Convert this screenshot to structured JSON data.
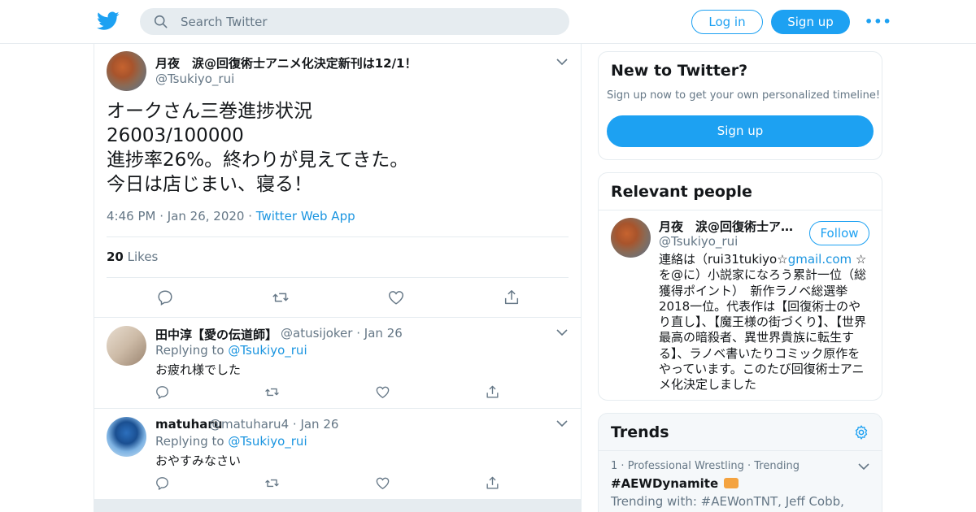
{
  "header": {
    "search_placeholder": "Search Twitter",
    "login_label": "Log in",
    "signup_label": "Sign up",
    "more_label": "•••"
  },
  "tweet": {
    "author_name": "月夜　涙@回復術士アニメ化決定新刊は12/1！",
    "author_handle": "@Tsukiyo_rui",
    "text_lines": [
      "オークさん三巻進捗状況",
      "26003/100000",
      "進捗率26%。終わりが見えてきた。",
      "今日は店じまい、寝る！"
    ],
    "time": "4:46 PM",
    "date": "Jan 26, 2020",
    "app": "Twitter Web App",
    "likes_count": "20",
    "likes_label": "Likes"
  },
  "replies": [
    {
      "name": "田中淳【愛の伝道師】",
      "handle": "@atusijoker",
      "date": "Jan 26",
      "replying_prefix": "Replying to",
      "replying_to": "@Tsukiyo_rui",
      "text": "お疲れ様でした"
    },
    {
      "name": "matuharu",
      "handle": "@matuharu4",
      "date": "Jan 26",
      "replying_prefix": "Replying to",
      "replying_to": "@Tsukiyo_rui",
      "text": "おやすみなさい"
    }
  ],
  "sidebar": {
    "new_to_twitter": {
      "title": "New to Twitter?",
      "subtitle": "Sign up now to get your own personalized timeline!",
      "button": "Sign up"
    },
    "relevant_people": {
      "title": "Relevant people",
      "name": "月夜　涙@回復術士ア…",
      "handle": "@Tsukiyo_rui",
      "follow_label": "Follow",
      "bio_prefix": "連絡は（rui31tukiyo☆",
      "bio_link": "gmail.com",
      "bio_rest": " ☆を@に）小説家になろう累計一位（総獲得ポイント）　新作ラノベ総選挙2018一位。代表作は【回復術士のやり直し】、【魔王様の街づくり】、【世界最高の暗殺者、異世界貴族に転生する】、ラノベ書いたりコミック原作をやっています。このたび回復術士アニメ化決定しました"
    },
    "trends": {
      "title": "Trends",
      "rank": "1",
      "category": "Professional Wrestling",
      "status": "Trending",
      "name": "#AEWDynamite",
      "trending_with": "Trending with: #AEWonTNT, Jeff Cobb,"
    }
  },
  "colors": {
    "accent": "#1da1f2",
    "link": "#1b95e0",
    "muted": "#657786",
    "border": "#e6ecf0"
  },
  "icons": [
    "twitter-bird-icon",
    "search-icon",
    "chevron-down-icon",
    "reply-icon",
    "retweet-icon",
    "like-icon",
    "share-icon",
    "gear-icon"
  ]
}
